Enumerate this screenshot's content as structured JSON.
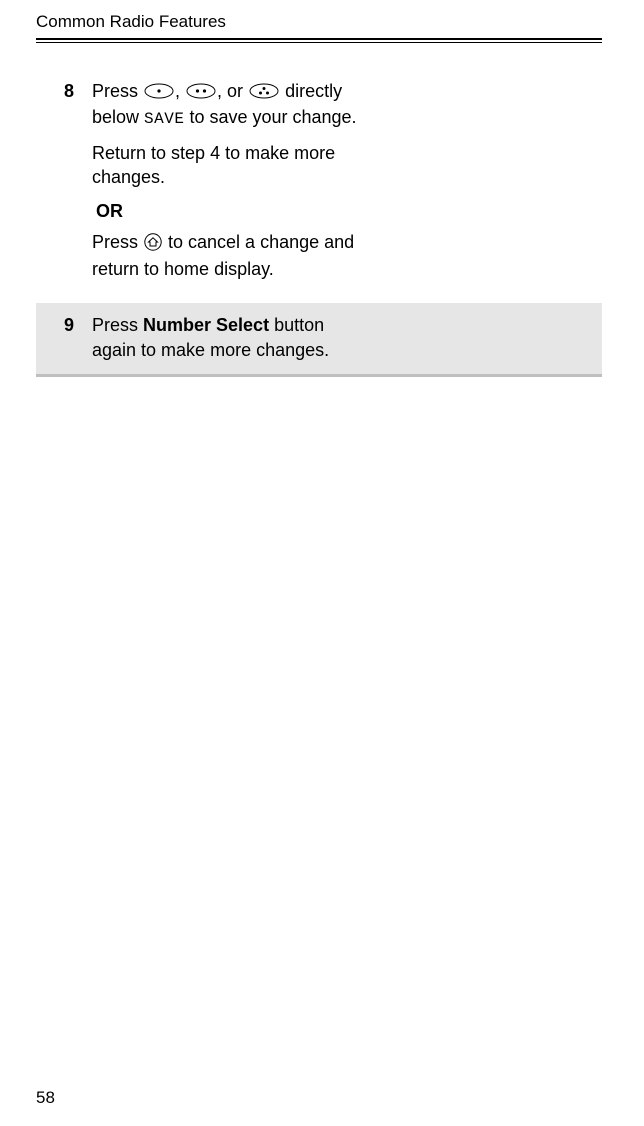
{
  "header": {
    "title": "Common Radio Features"
  },
  "steps": [
    {
      "num": "8",
      "part1_pre": "Press ",
      "part1_mid1": ", ",
      "part1_mid2": ", or ",
      "part1_post1": " directly below ",
      "save_label": "SAVE",
      "part1_post2": " to save your change.",
      "part2": "Return to step 4 to make more changes.",
      "or": "OR",
      "part3_pre": "Press ",
      "part3_post": " to cancel a change and return to home display."
    },
    {
      "num": "9",
      "pre": "Press ",
      "bold": "Number Select",
      "post": " button again to make more changes."
    }
  ],
  "footer": {
    "page": "58"
  }
}
